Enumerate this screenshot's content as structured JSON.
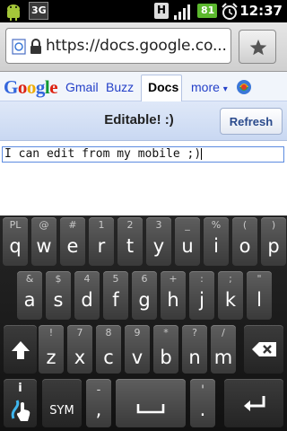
{
  "status_bar": {
    "network": "3G",
    "battery_level": "81",
    "time": "12:37",
    "icons": [
      "android-debug-icon",
      "3g-icon",
      "h-data-icon",
      "signal-icon",
      "battery-icon",
      "alarm-icon"
    ]
  },
  "browser": {
    "url": "https://docs.google.co...",
    "icons": [
      "page-favicon-icon",
      "lock-icon",
      "bookmark-star-icon"
    ]
  },
  "google_nav": {
    "logo": "Google",
    "links": [
      "Gmail",
      "Buzz",
      "Docs",
      "more"
    ],
    "active": "Docs",
    "more_arrow": "▾",
    "colors": {
      "link": "#2440c8",
      "g_blue": "#3366dd",
      "g_red": "#dd2211",
      "g_yellow": "#eeaa00",
      "g_green": "#119933"
    }
  },
  "editor_bar": {
    "title": "Editable! :)",
    "refresh_label": "Refresh"
  },
  "editor": {
    "text": "I can edit from my mobile ;)"
  },
  "keyboard": {
    "row1": [
      {
        "hint": "PL",
        "main": "q"
      },
      {
        "hint": "@",
        "main": "w"
      },
      {
        "hint": "#",
        "main": "e"
      },
      {
        "hint": "1",
        "main": "r"
      },
      {
        "hint": "2",
        "main": "t"
      },
      {
        "hint": "3",
        "main": "y"
      },
      {
        "hint": "_",
        "main": "u"
      },
      {
        "hint": "%",
        "main": "i"
      },
      {
        "hint": "(",
        "main": "o"
      },
      {
        "hint": ")",
        "main": "p"
      }
    ],
    "row2": [
      {
        "hint": "&",
        "main": "a"
      },
      {
        "hint": "$",
        "main": "s"
      },
      {
        "hint": "4",
        "main": "d"
      },
      {
        "hint": "5",
        "main": "f"
      },
      {
        "hint": "6",
        "main": "g"
      },
      {
        "hint": "+",
        "main": "h"
      },
      {
        "hint": ":",
        "main": "j"
      },
      {
        "hint": ";",
        "main": "k"
      },
      {
        "hint": "\"",
        "main": "l"
      }
    ],
    "row3": [
      {
        "hint": "!",
        "main": "z"
      },
      {
        "hint": "7",
        "main": "x"
      },
      {
        "hint": "8",
        "main": "c"
      },
      {
        "hint": "9",
        "main": "v"
      },
      {
        "hint": "*",
        "main": "b"
      },
      {
        "hint": "?",
        "main": "n"
      },
      {
        "hint": "/",
        "main": "m"
      }
    ],
    "row4": {
      "sym_label": "SYM",
      "comma_hint": "-",
      "comma_main": ",",
      "period_hint": "'",
      "period_main": ".",
      "info_hint": "i"
    }
  }
}
